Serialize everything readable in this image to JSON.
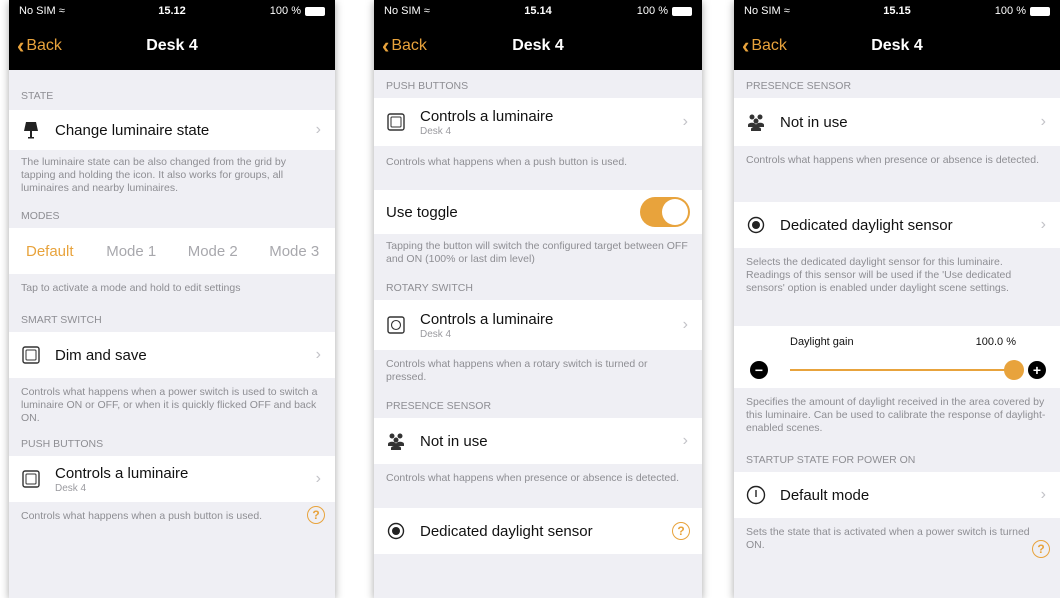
{
  "status": {
    "carrier": "No SIM",
    "battery": "100 %"
  },
  "nav": {
    "back_label": "Back",
    "title": "Desk 4"
  },
  "accent": "#e8a33c",
  "screens": [
    {
      "time": "15.12",
      "state_header": "STATE",
      "change_state_label": "Change luminaire state",
      "state_note": "The luminaire state can be also changed from the grid by tapping and holding the icon. It also works for groups, all luminaires and nearby luminaires.",
      "modes_header": "MODES",
      "modes": [
        "Default",
        "Mode 1",
        "Mode 2",
        "Mode 3"
      ],
      "modes_note": "Tap to activate a mode and hold to edit settings",
      "smart_header": "SMART SWITCH",
      "smart_label": "Dim and save",
      "smart_note": "Controls what happens when a power switch is used to switch a luminaire ON or OFF, or when it is quickly flicked OFF and back ON.",
      "push_header": "PUSH BUTTONS",
      "push_label": "Controls a luminaire",
      "push_sub": "Desk 4",
      "push_note": "Controls what happens when a push button is used."
    },
    {
      "time": "15.14",
      "push_header": "PUSH BUTTONS",
      "push_label": "Controls a luminaire",
      "push_sub": "Desk 4",
      "push_note": "Controls what happens when a push button is used.",
      "toggle_label": "Use toggle",
      "toggle_note": "Tapping the button will switch the configured target between OFF and ON (100% or last dim level)",
      "rotary_header": "ROTARY SWITCH",
      "rotary_label": "Controls a luminaire",
      "rotary_sub": "Desk 4",
      "rotary_note": "Controls what happens when a rotary switch is turned or pressed.",
      "presence_header": "PRESENCE SENSOR",
      "presence_label": "Not in use",
      "presence_note": "Controls what happens when presence or absence is detected.",
      "daylight_label": "Dedicated daylight sensor"
    },
    {
      "time": "15.15",
      "presence_header": "PRESENCE SENSOR",
      "presence_label": "Not in use",
      "presence_note": "Controls what happens when presence or absence is detected.",
      "daylight_label": "Dedicated daylight sensor",
      "daylight_note": "Selects the dedicated daylight sensor for this luminaire. Readings of this sensor will be used if the 'Use dedicated sensors' option is enabled under daylight scene settings.",
      "gain_label": "Daylight gain",
      "gain_value": "100.0 %",
      "gain_fraction": 1.0,
      "gain_note": "Specifies the amount of daylight received in the area covered by this luminaire. Can be used to calibrate the response of daylight-enabled scenes.",
      "startup_header": "STARTUP STATE FOR POWER ON",
      "startup_label": "Default mode",
      "startup_note": "Sets the state that is activated when a power switch is turned ON."
    }
  ]
}
